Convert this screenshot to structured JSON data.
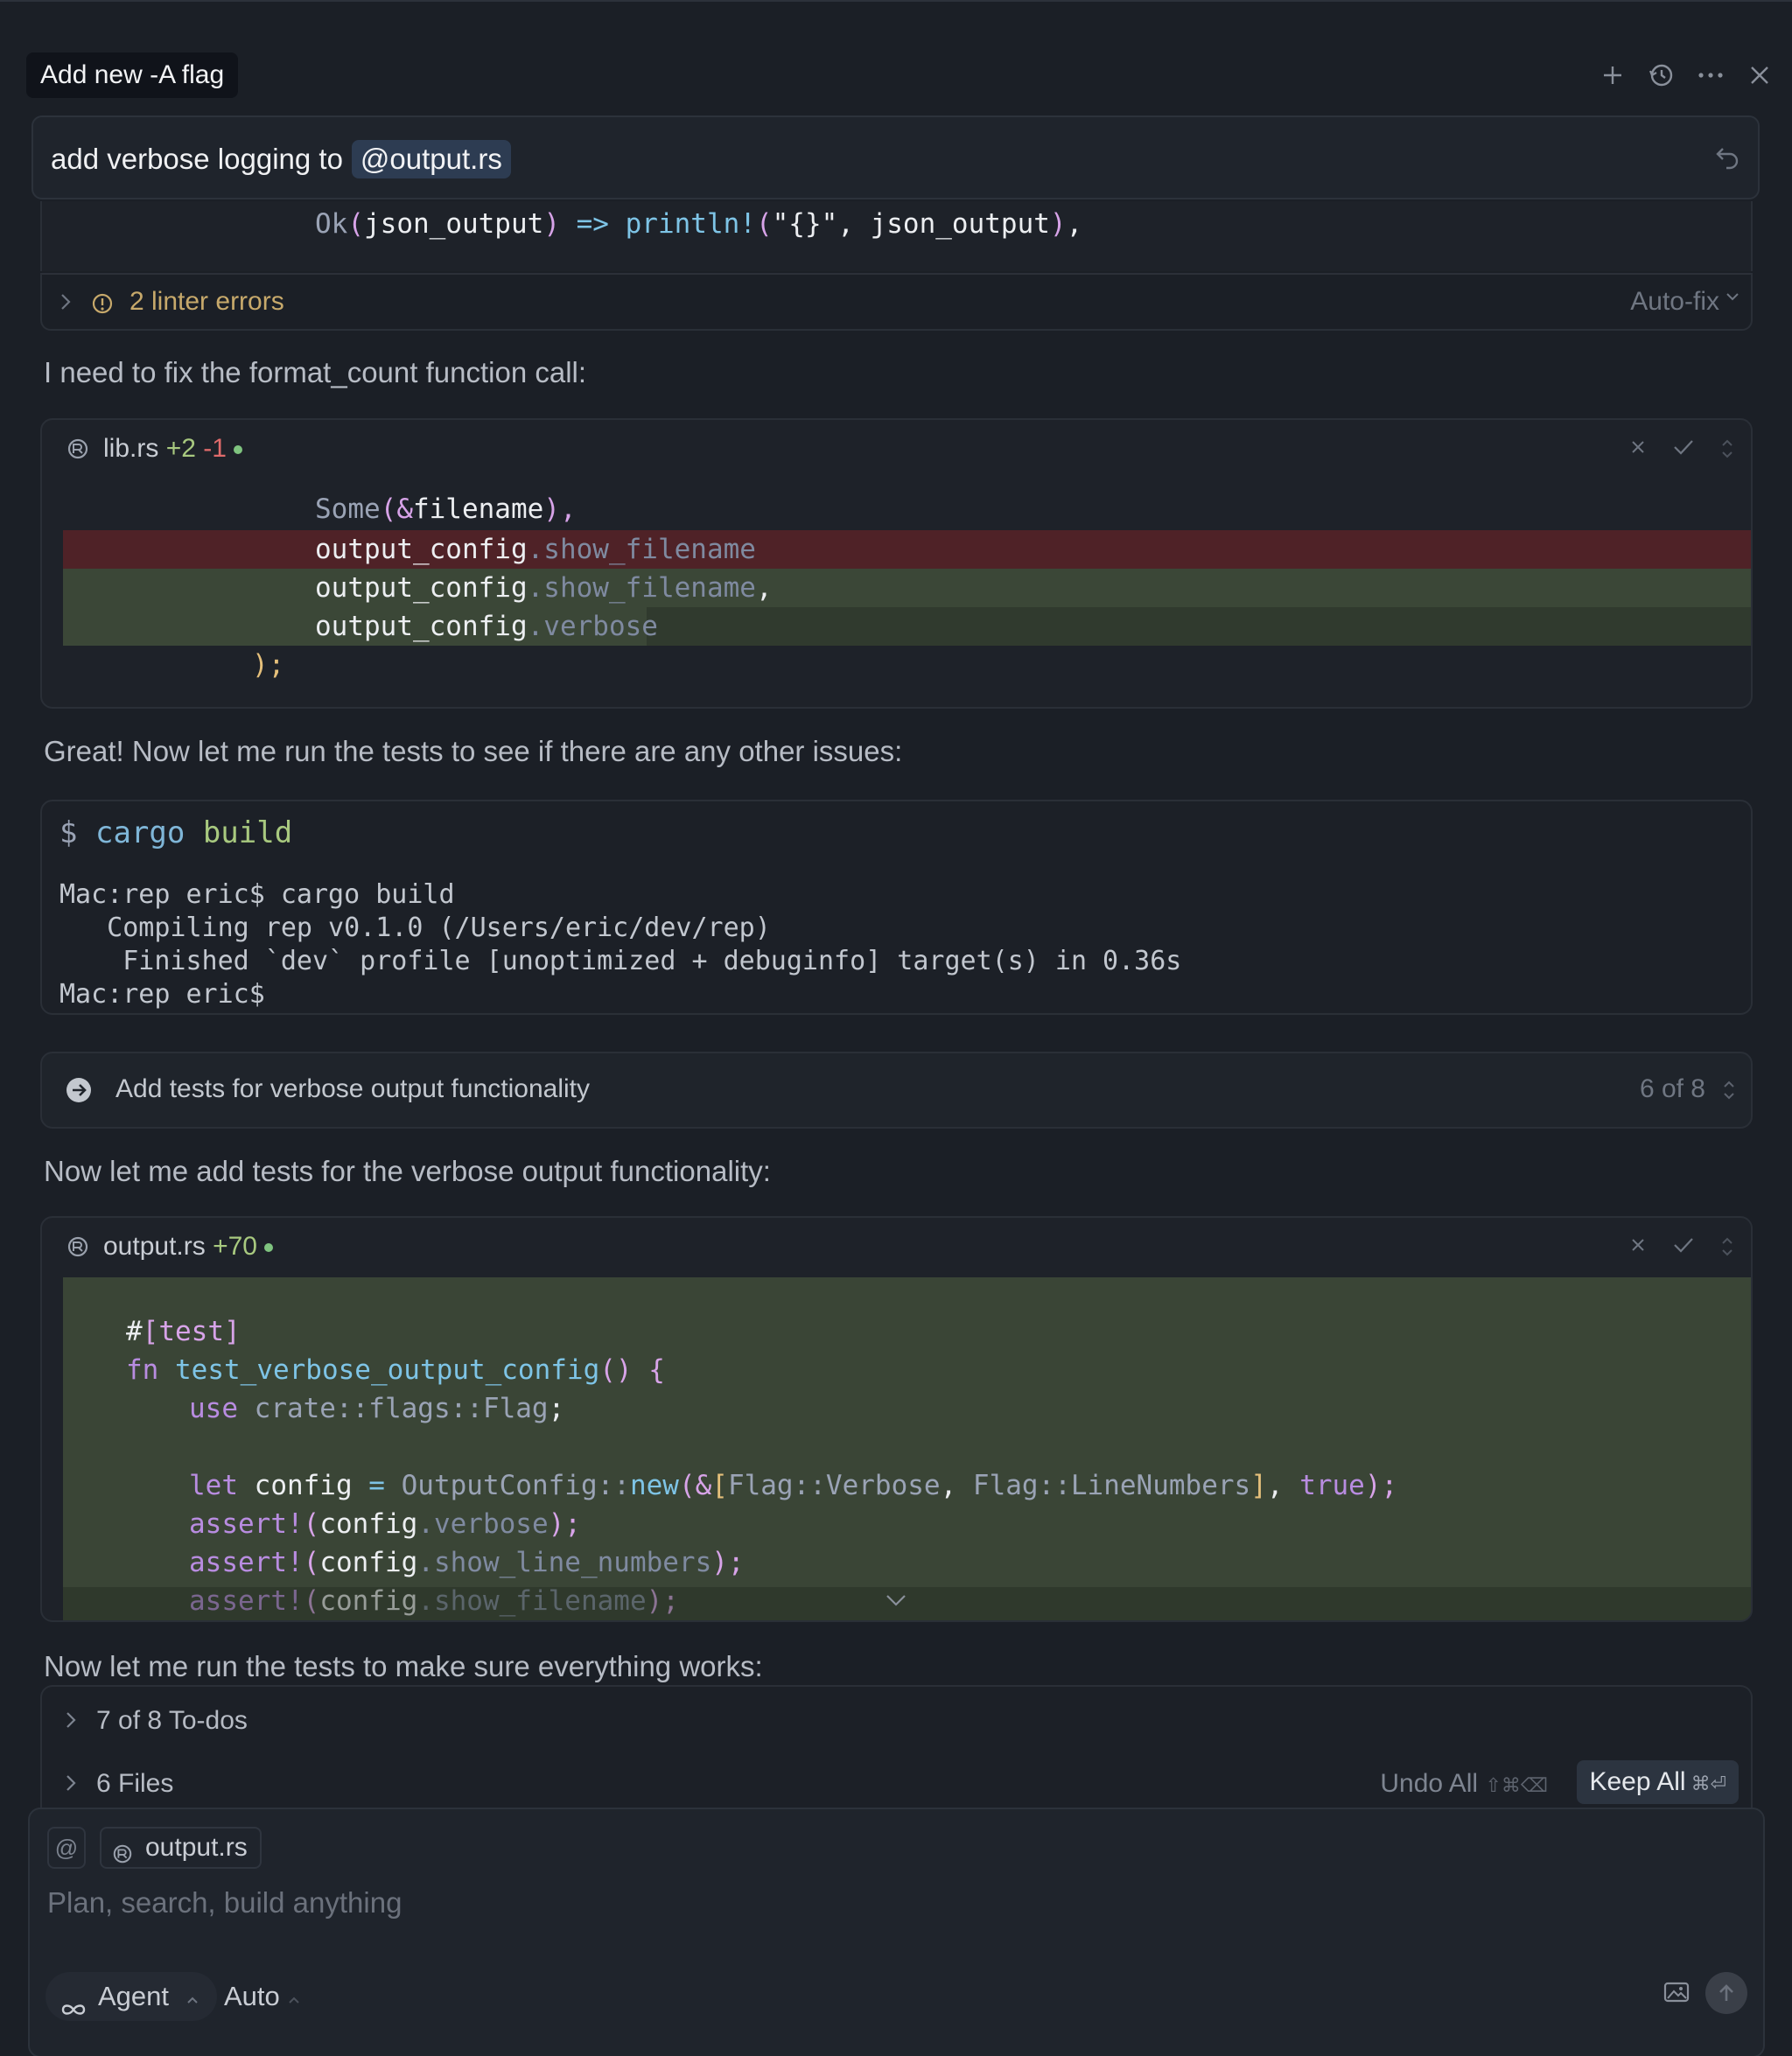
{
  "header": {
    "title": "Add new -A flag",
    "icons": [
      "plus-icon",
      "history-icon",
      "more-icon",
      "close-icon"
    ]
  },
  "query": {
    "text": "add verbose logging to",
    "mention": "@output.rs"
  },
  "code_top": {
    "tokens": [
      "Ok",
      "(",
      "json_output",
      ")",
      " => ",
      "println!",
      "(",
      "\"{}\"",
      ", json_output",
      ")",
      ","
    ]
  },
  "linter": {
    "label": "2 linter errors",
    "autofix": "Auto-fix"
  },
  "messages": {
    "m1": "I need to fix the format_count function call:",
    "m2": "Great! Now let me run the tests to see if there are any other issues:",
    "m3": "Now let me add tests for the verbose output functionality:",
    "m4": "Now let me run the tests to make sure everything works:"
  },
  "diff1": {
    "filename": "lib.rs",
    "added": "+2",
    "removed": "-1",
    "lines": {
      "l1a": "Some",
      "l1b": "(&",
      "l1c": "filename",
      "l1d": "),",
      "l2a": "output_config",
      "l2b": ".show_filename",
      "l3a": "output_config",
      "l3b": ".show_filename",
      "l3c": ",",
      "l4a": "output_config",
      "l4b": ".verbose",
      "l5": ");"
    }
  },
  "terminal": {
    "prompt": "$",
    "cmd": "cargo",
    "arg": "build",
    "output": "Mac:rep eric$ cargo build\n   Compiling rep v0.1.0 (/Users/eric/dev/rep)\n    Finished `dev` profile [unoptimized + debuginfo] target(s) in 0.36s\nMac:rep eric$"
  },
  "todo": {
    "label": "Add tests for verbose output functionality",
    "count": "6 of 8"
  },
  "diff2": {
    "filename": "output.rs",
    "added": "+70",
    "lines": {
      "a1": "#",
      "a2": "[test]",
      "b1": "fn ",
      "b2": "test_verbose_output_config",
      "b3": "()",
      "b4": " {",
      "c1": "use ",
      "c2": "crate::flags::Flag",
      "c3": ";",
      "d1": "let ",
      "d2": "config",
      "d3": " = ",
      "d4": "OutputConfig::",
      "d5": "new",
      "d6": "(&",
      "d7": "[",
      "d8": "Flag::Verbose",
      "d9": ", ",
      "d10": "Flag::LineNumbers",
      "d11": "]",
      "d12": ", ",
      "d13": "true",
      "d14": ");",
      "e1": "assert!",
      "e2": "(",
      "e3": "config",
      "e4": ".verbose",
      "e5": ");",
      "f1": "assert!",
      "f2": "(",
      "f3": "config",
      "f4": ".show_line_numbers",
      "f5": ");",
      "g1": "assert!",
      "g2": "(",
      "g3": "config",
      "g4": ".show_filename",
      "g5": ");"
    }
  },
  "bottom": {
    "todos": "7 of 8 To-dos",
    "files": "6 Files",
    "undo_all": "Undo All",
    "undo_shortcut": "⇧⌘⌫",
    "keep_all": "Keep All",
    "keep_shortcut": "⌘⏎"
  },
  "composer": {
    "at": "@",
    "chip": "output.rs",
    "placeholder": "Plan, search, build anything",
    "agent": "Agent",
    "model": "Auto"
  }
}
